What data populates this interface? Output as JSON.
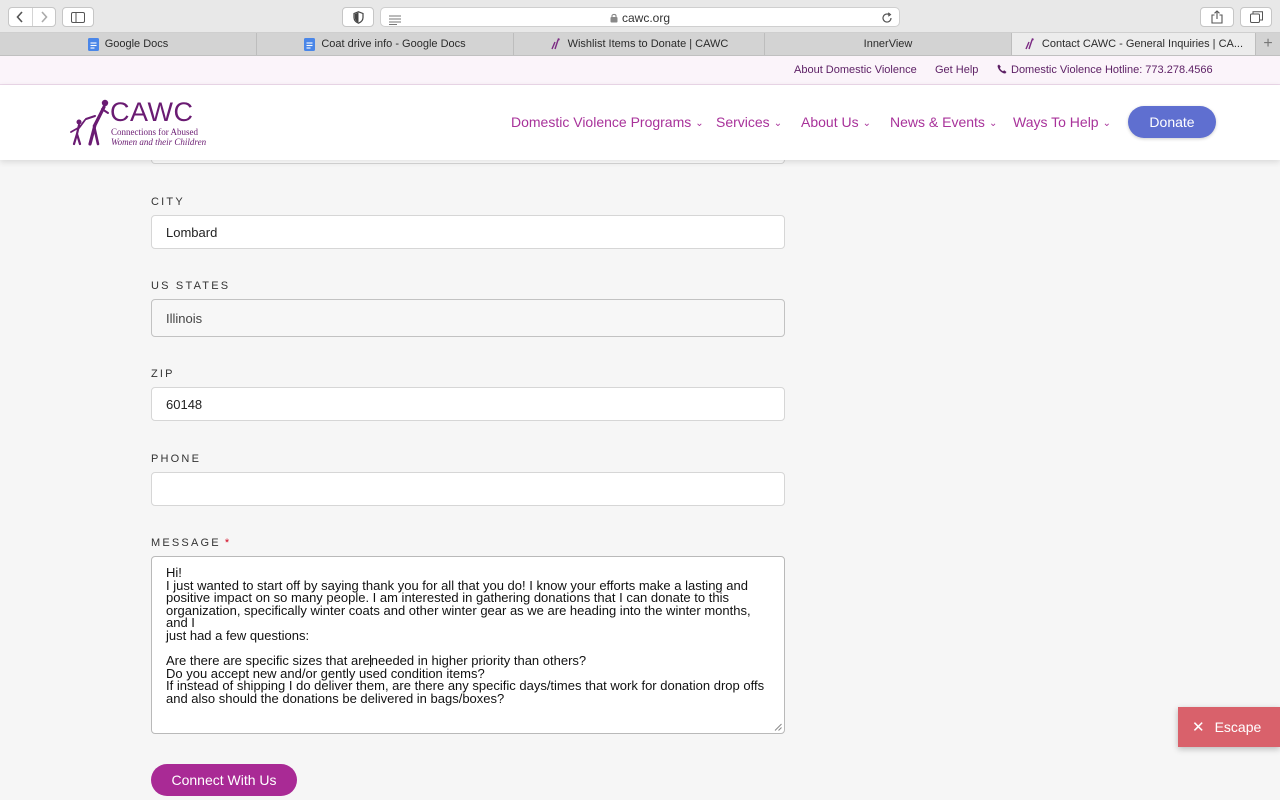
{
  "browser": {
    "url": "cawc.org",
    "tabs": [
      {
        "label": "Google Docs",
        "favicon": "google-docs-icon",
        "active": false
      },
      {
        "label": "Coat drive info - Google Docs",
        "favicon": "google-docs-icon",
        "active": false
      },
      {
        "label": "Wishlist Items to Donate | CAWC",
        "favicon": "cawc-icon",
        "active": false
      },
      {
        "label": "InnerView",
        "favicon": "",
        "active": false
      },
      {
        "label": "Contact CAWC - General Inquiries | CA...",
        "favicon": "cawc-icon",
        "active": true
      }
    ]
  },
  "utility_nav": {
    "about_dv": "About Domestic Violence",
    "get_help": "Get Help",
    "hotline": "Domestic Violence Hotline: 773.278.4566"
  },
  "logo": {
    "name": "CAWC",
    "tagline_line1": "Connections for Abused",
    "tagline_line2": "Women and their Children"
  },
  "main_nav": {
    "items": [
      "Domestic Violence Programs",
      "Services",
      "About Us",
      "News & Events",
      "Ways To Help"
    ],
    "donate": "Donate"
  },
  "form": {
    "city": {
      "label": "CITY",
      "value": "Lombard"
    },
    "state": {
      "label": "US STATES",
      "value": "Illinois"
    },
    "zip": {
      "label": "ZIP",
      "value": "60148"
    },
    "phone": {
      "label": "PHONE",
      "value": ""
    },
    "message": {
      "label": "MESSAGE",
      "required_mark": "*",
      "text_before_caret": "Hi!\nI just wanted to start off by saying thank you for all that you do! I know your efforts make a lasting and\npositive impact on so many people. I am interested in gathering donations that I can donate to this\norganization, specifically winter coats and other winter gear as we are heading into the winter months, and I\njust had a few questions:\n\nAre there are specific sizes that are",
      "text_after_caret": "needed in higher priority than others?\nDo you accept new and/or gently used condition items?\nIf instead of shipping I do deliver them, are there any specific days/times that work for donation drop offs\nand also should the donations be delivered in bags/boxes?"
    },
    "submit": "Connect With Us"
  },
  "escape": {
    "label": "Escape"
  },
  "colors": {
    "brand_purple": "#6a1b72",
    "nav_magenta": "#a8329a",
    "donate_blue": "#5f6fd0",
    "submit_magenta": "#a92a95",
    "escape_red": "#d9616b"
  }
}
